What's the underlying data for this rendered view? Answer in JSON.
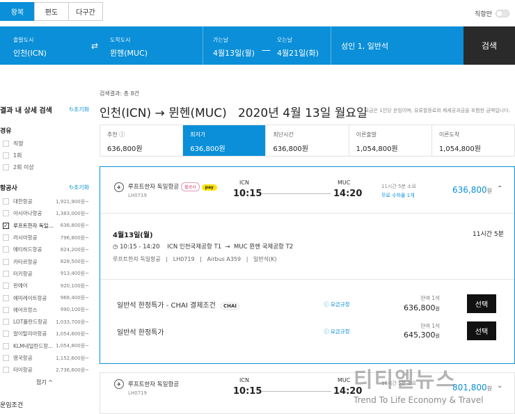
{
  "trip_tabs": [
    "왕복",
    "편도",
    "다구간"
  ],
  "direct_only_label": "직항만",
  "search_bar": {
    "origin_label": "출발도시",
    "origin_value": "인천(ICN)",
    "dest_label": "도착도시",
    "dest_value": "뮌헨(MUC)",
    "depart_label": "가는날",
    "depart_value": "4월13일(월)",
    "return_label": "오는날",
    "return_value": "4월21일(화)",
    "passengers": "성인 1, 일반석",
    "search_button": "검색",
    "swap_icon": "swap-arrows-icon",
    "dash": "—"
  },
  "sidebar": {
    "title": "결과 내 상세 검색",
    "reset": "초기화",
    "stops_title": "경유",
    "stops": [
      "직항",
      "1회",
      "2회 이상"
    ],
    "airlines_title": "항공사",
    "airlines_reset": "초기화",
    "airlines": [
      {
        "name": "대한항공",
        "price": "1,921,900원~",
        "checked": false
      },
      {
        "name": "아시아나항공",
        "price": "1,383,000원~",
        "checked": false
      },
      {
        "name": "루프트한자 독일...",
        "price": "636,800원~",
        "checked": true
      },
      {
        "name": "러시아항공",
        "price": "796,800원~",
        "checked": false
      },
      {
        "name": "에티하드항공",
        "price": "824,200원~",
        "checked": false
      },
      {
        "name": "카타르항공",
        "price": "828,500원~",
        "checked": false
      },
      {
        "name": "터키항공",
        "price": "913,400원~",
        "checked": false
      },
      {
        "name": "핀에어",
        "price": "920,100원~",
        "checked": false
      },
      {
        "name": "에미레이트항공",
        "price": "968,400원~",
        "checked": false
      },
      {
        "name": "에어프랑스",
        "price": "990,100원~",
        "checked": false
      },
      {
        "name": "LOT폴란드항공",
        "price": "1,033,700원~",
        "checked": false
      },
      {
        "name": "알이탈리아항공",
        "price": "1,054,600원~",
        "checked": false
      },
      {
        "name": "KLM네덜란드항...",
        "price": "1,054,800원~",
        "checked": false
      },
      {
        "name": "영국항공",
        "price": "1,152,600원~",
        "checked": false
      },
      {
        "name": "타이항공",
        "price": "2,736,600원~",
        "checked": false
      }
    ],
    "collapse": "접기 ^",
    "bottom_title": "운임조건"
  },
  "results": {
    "count_text": "검색결과: 총 8건",
    "route_title": "인천(ICN) → 뮌헨(MUC)",
    "date_title": "2020년 4월 13일 월요일",
    "note": "* 요금은 1인당 운임이며, 유류할증료와 제세공과금을 포함한 금액입니다.",
    "sort_options": [
      {
        "label": "추천",
        "value": "636,800원",
        "active": false
      },
      {
        "label": "최저가",
        "value": "636,800원",
        "active": true
      },
      {
        "label": "최단시간",
        "value": "636,800원",
        "active": false
      },
      {
        "label": "이른출발",
        "value": "1,054,800원",
        "active": false
      },
      {
        "label": "이른도착",
        "value": "1,054,800원",
        "active": false
      }
    ]
  },
  "flight1": {
    "airline": "루프트한자 독일항공",
    "badge": "할공사",
    "pay_badge": "pay",
    "flight_no": "LH0719",
    "dep_code": "ICN",
    "dep_time": "10:15",
    "arr_code": "MUC",
    "arr_time": "14:20",
    "duration": "11시간 5분 소요",
    "baggage": "무료 수하물 1개",
    "price": "636,800",
    "currency": "원",
    "detail_date": "4월13일(월)",
    "detail_duration": "11시간 5분",
    "detail_route": "10:15 - 14:20    ICN 인천국제공항 T1  →  MUC 뮌헨 국제공항 T2",
    "detail_info": "루프트한자 독일항공   |   LH0719   |   Airbus A359   |   일반석(K)",
    "fares": [
      {
        "name": "일반석 한정특가 - CHAI 결제조건",
        "chai": "CHAI",
        "rule": "요금규정",
        "remain": "잔여 1석",
        "price": "636,800",
        "currency": "원",
        "button": "선택"
      },
      {
        "name": "일반석 한정특가",
        "chai": "",
        "rule": "요금규정",
        "remain": "잔여 1석",
        "price": "645,300",
        "currency": "원",
        "button": "선택"
      }
    ]
  },
  "flight2": {
    "airline": "루프트한자 독일항공",
    "flight_no": "LH0719",
    "dep_code": "ICN",
    "dep_time": "10:15",
    "arr_code": "MUC",
    "arr_time": "14:20",
    "duration": "11시간 5분 소요",
    "price": "801,800",
    "currency": "원"
  },
  "watermark": {
    "title": "티티엘뉴스",
    "subtitle": "Trend To Life Economy & Travel"
  }
}
